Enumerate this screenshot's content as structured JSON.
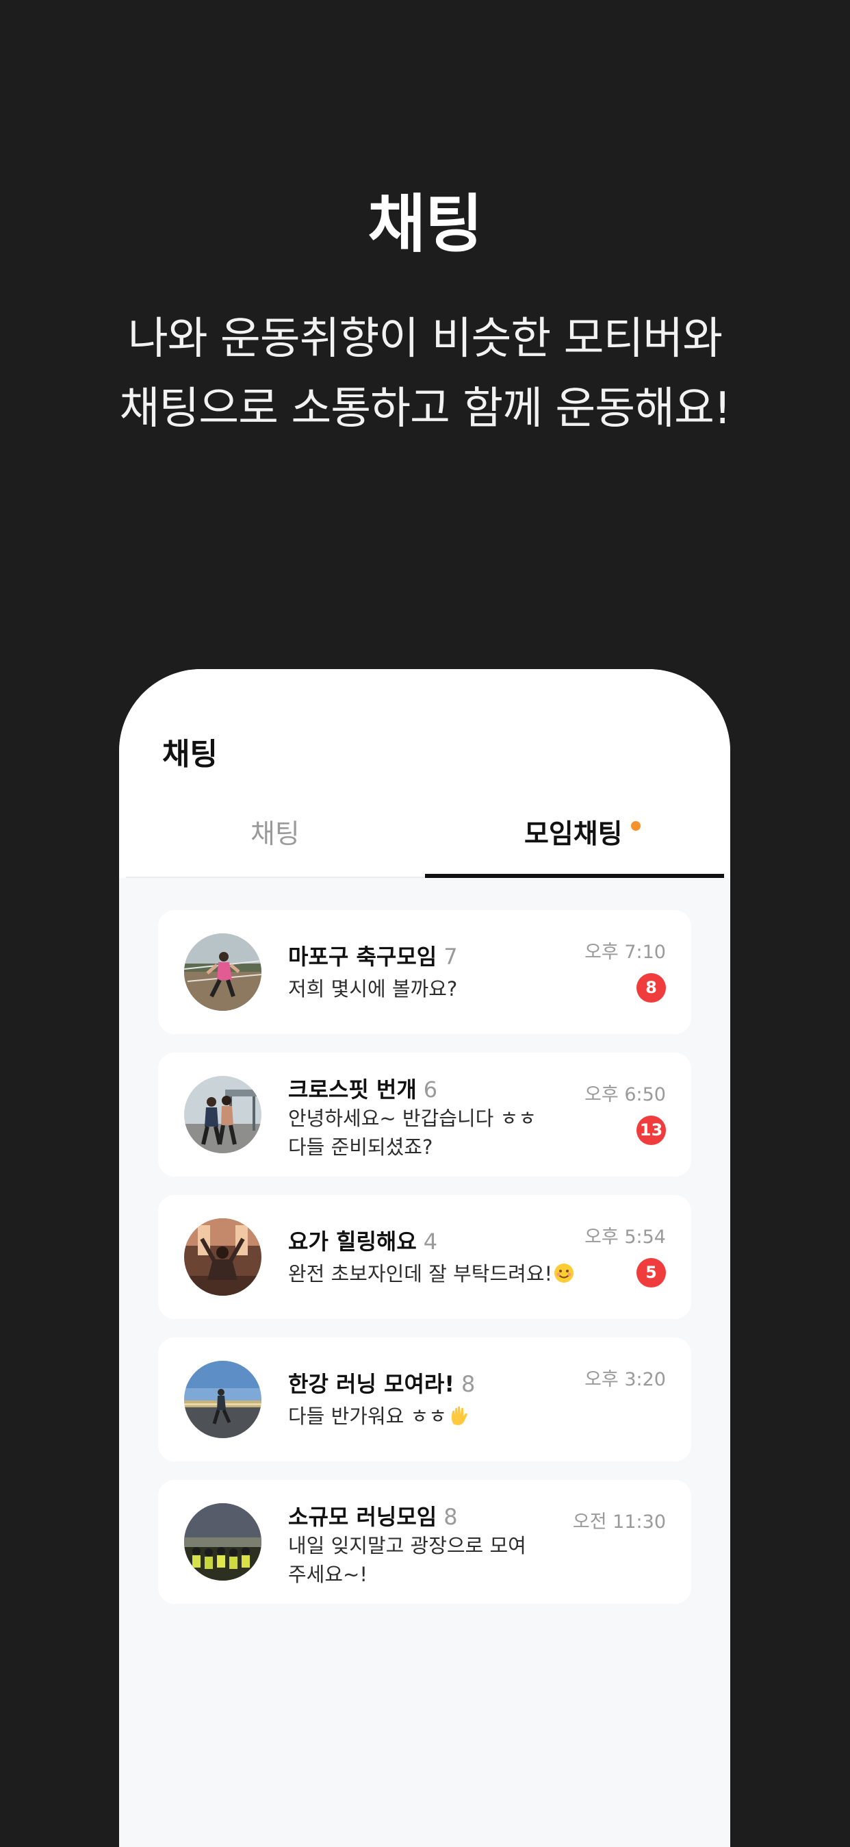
{
  "hero": {
    "title": "채팅",
    "subtitle_line1": "나와 운동취향이 비슷한 모티버와",
    "subtitle_line2": "채팅으로 소통하고 함께 운동해요!"
  },
  "screen": {
    "title": "채팅",
    "tabs": [
      {
        "label": "채팅",
        "active": false
      },
      {
        "label": "모임채팅",
        "active": true,
        "has_new_dot": true
      }
    ]
  },
  "rooms": [
    {
      "name": "마포구 축구모임",
      "count": "7",
      "last_message": "저희 몇시에 볼까요?",
      "time": "오후 7:10",
      "unread": "8",
      "avatar": "soccer-photo"
    },
    {
      "name": "크로스핏 번개",
      "count": "6",
      "last_message": "안녕하세요~ 반갑습니다 ㅎㅎ\n다들 준비되셨죠?",
      "time": "오후 6:50",
      "unread": "13",
      "avatar": "crossfit-photo"
    },
    {
      "name": "요가 힐링해요",
      "count": "4",
      "last_message": "완전 초보자인데 잘 부탁드려요!",
      "emoji": "smiling-face-emoji",
      "time": "오후 5:54",
      "unread": "5",
      "avatar": "yoga-photo"
    },
    {
      "name": "한강 러닝 모여라!",
      "count": "8",
      "last_message": "다들 반가워요 ㅎㅎ",
      "emoji": "waving-hand-emoji",
      "time": "오후 3:20",
      "unread": "",
      "avatar": "river-running-photo"
    },
    {
      "name": "소규모 러닝모임",
      "count": "8",
      "last_message": "내일 잊지말고 광장으로 모여\n주세요~!",
      "time": "오전 11:30",
      "unread": "",
      "avatar": "group-running-photo"
    }
  ],
  "colors": {
    "background": "#1d1d1d",
    "accent_dot": "#f5922b",
    "badge": "#f03c3c",
    "muted_text": "#9a9a9a"
  }
}
